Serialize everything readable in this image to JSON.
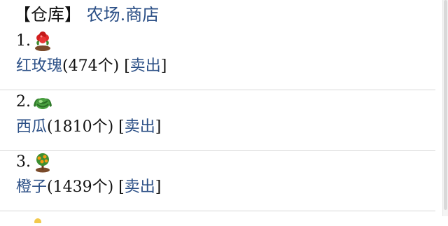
{
  "header": {
    "bracket_open": "【",
    "title": "仓库",
    "bracket_close": "】",
    "link_farm": "农场",
    "separator": ".",
    "link_shop": "商店"
  },
  "items": [
    {
      "index": "1.",
      "icon": "rose-icon",
      "name": "红玫瑰",
      "count": "(474个)",
      "sell_open": "[",
      "sell_label": "卖出",
      "sell_close": "]"
    },
    {
      "index": "2.",
      "icon": "watermelon-icon",
      "name": "西瓜",
      "count": "(1810个)",
      "sell_open": "[",
      "sell_label": "卖出",
      "sell_close": "]"
    },
    {
      "index": "3.",
      "icon": "orange-tree-icon",
      "name": "橙子",
      "count": "(1439个)",
      "sell_open": "[",
      "sell_label": "卖出",
      "sell_close": "]"
    }
  ],
  "colors": {
    "link": "#2b4f86",
    "divider": "#d8d8d8"
  }
}
